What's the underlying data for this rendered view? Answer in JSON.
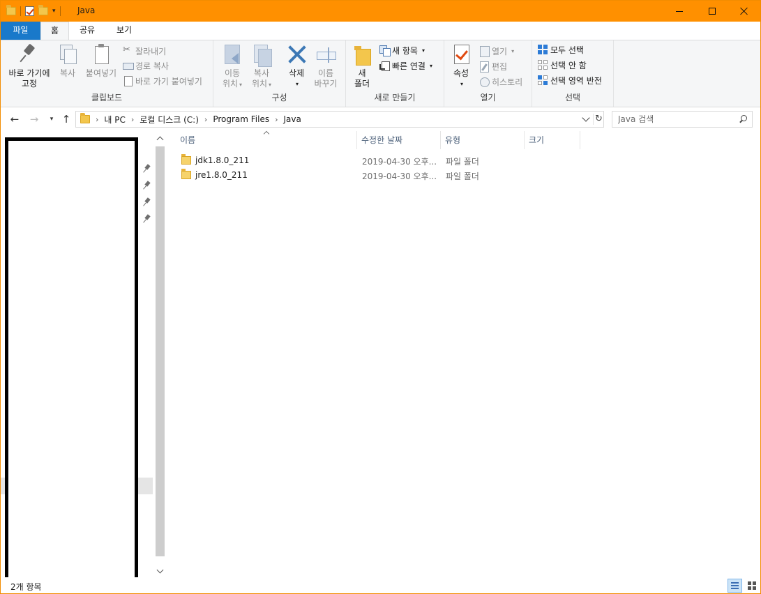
{
  "window": {
    "title": "Java",
    "accent_color": "#ff9000"
  },
  "ribbon_tabs": {
    "file": "파일",
    "home": "홈",
    "share": "공유",
    "view": "보기"
  },
  "ribbon": {
    "clipboard": {
      "label": "클립보드",
      "pin_line1": "바로 가기에",
      "pin_line2": "고정",
      "copy": "복사",
      "paste": "붙여넣기",
      "cut": "잘라내기",
      "copy_path": "경로 복사",
      "paste_shortcut": "바로 가기 붙여넣기"
    },
    "organize": {
      "label": "구성",
      "move_line1": "이동",
      "move_line2": "위치",
      "copyto_line1": "복사",
      "copyto_line2": "위치",
      "delete": "삭제",
      "rename_line1": "이름",
      "rename_line2": "바꾸기"
    },
    "new": {
      "label": "새로 만들기",
      "new_folder_line1": "새",
      "new_folder_line2": "폴더",
      "new_item": "새 항목",
      "easy_access": "빠른 연결"
    },
    "open": {
      "label": "열기",
      "properties": "속성",
      "open": "열기",
      "edit": "편집",
      "history": "히스토리"
    },
    "select": {
      "label": "선택",
      "select_all": "모두 선택",
      "select_none": "선택 안 함",
      "invert": "선택 영역 반전"
    }
  },
  "address": {
    "crumbs": [
      "내 PC",
      "로컬 디스크 (C:)",
      "Program Files",
      "Java"
    ],
    "search_placeholder": "Java 검색"
  },
  "columns": {
    "name": "이름",
    "date": "수정한 날짜",
    "type": "유형",
    "size": "크기"
  },
  "files": [
    {
      "name": "jdk1.8.0_211",
      "date": "2019-04-30 오후...",
      "type": "파일 폴더"
    },
    {
      "name": "jre1.8.0_211",
      "date": "2019-04-30 오후...",
      "type": "파일 폴더"
    }
  ],
  "status": {
    "item_count": "2개 항목"
  }
}
